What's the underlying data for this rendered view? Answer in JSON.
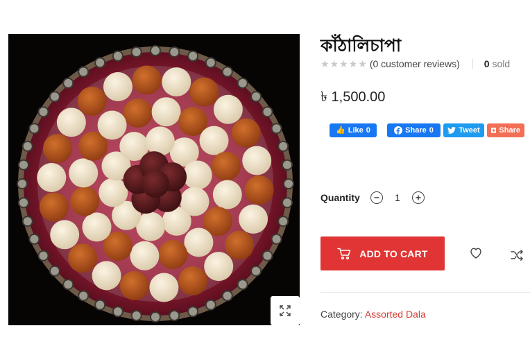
{
  "product": {
    "title": "কাঁঠালিচাপা",
    "rating": {
      "stars_filled": 0,
      "stars_total": 5,
      "reviews_text": "(0 customer reviews)",
      "sold_count": "0",
      "sold_label": "sold"
    },
    "price": "৳ 1,500.00",
    "image": {
      "zoom_icon": "expand-icon"
    }
  },
  "share": {
    "fb_like_label": "Like",
    "fb_like_count": "0",
    "fb_share_label": "Share",
    "fb_share_count": "0",
    "tweet_label": "Tweet",
    "plus_share_label": "Share"
  },
  "quantity": {
    "label": "Quantity",
    "value": "1"
  },
  "cart": {
    "add_label": "ADD TO CART"
  },
  "meta": {
    "category_label": "Category:",
    "category_value": "Assorted Dala"
  },
  "colors": {
    "accent": "#e03534",
    "link": "#d23c33",
    "facebook": "#1877f2",
    "twitter": "#1d9bf0",
    "share_plus": "#f26f55"
  }
}
